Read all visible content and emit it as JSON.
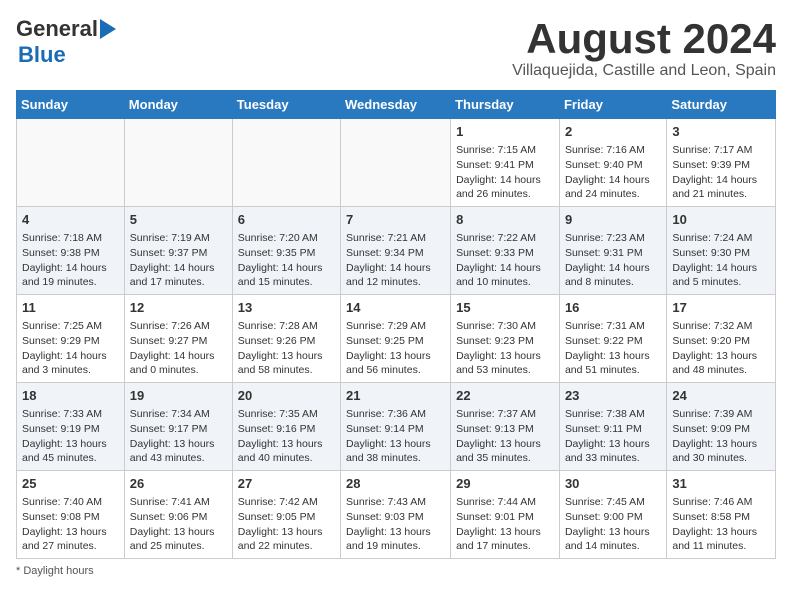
{
  "title": "August 2024",
  "subtitle": "Villaquejida, Castille and Leon, Spain",
  "logo": {
    "line1": "General",
    "line2": "Blue"
  },
  "footer_note": "Daylight hours",
  "days_of_week": [
    "Sunday",
    "Monday",
    "Tuesday",
    "Wednesday",
    "Thursday",
    "Friday",
    "Saturday"
  ],
  "weeks": [
    [
      {
        "day": "",
        "info": ""
      },
      {
        "day": "",
        "info": ""
      },
      {
        "day": "",
        "info": ""
      },
      {
        "day": "",
        "info": ""
      },
      {
        "day": "1",
        "info": "Sunrise: 7:15 AM\nSunset: 9:41 PM\nDaylight: 14 hours and 26 minutes."
      },
      {
        "day": "2",
        "info": "Sunrise: 7:16 AM\nSunset: 9:40 PM\nDaylight: 14 hours and 24 minutes."
      },
      {
        "day": "3",
        "info": "Sunrise: 7:17 AM\nSunset: 9:39 PM\nDaylight: 14 hours and 21 minutes."
      }
    ],
    [
      {
        "day": "4",
        "info": "Sunrise: 7:18 AM\nSunset: 9:38 PM\nDaylight: 14 hours and 19 minutes."
      },
      {
        "day": "5",
        "info": "Sunrise: 7:19 AM\nSunset: 9:37 PM\nDaylight: 14 hours and 17 minutes."
      },
      {
        "day": "6",
        "info": "Sunrise: 7:20 AM\nSunset: 9:35 PM\nDaylight: 14 hours and 15 minutes."
      },
      {
        "day": "7",
        "info": "Sunrise: 7:21 AM\nSunset: 9:34 PM\nDaylight: 14 hours and 12 minutes."
      },
      {
        "day": "8",
        "info": "Sunrise: 7:22 AM\nSunset: 9:33 PM\nDaylight: 14 hours and 10 minutes."
      },
      {
        "day": "9",
        "info": "Sunrise: 7:23 AM\nSunset: 9:31 PM\nDaylight: 14 hours and 8 minutes."
      },
      {
        "day": "10",
        "info": "Sunrise: 7:24 AM\nSunset: 9:30 PM\nDaylight: 14 hours and 5 minutes."
      }
    ],
    [
      {
        "day": "11",
        "info": "Sunrise: 7:25 AM\nSunset: 9:29 PM\nDaylight: 14 hours and 3 minutes."
      },
      {
        "day": "12",
        "info": "Sunrise: 7:26 AM\nSunset: 9:27 PM\nDaylight: 14 hours and 0 minutes."
      },
      {
        "day": "13",
        "info": "Sunrise: 7:28 AM\nSunset: 9:26 PM\nDaylight: 13 hours and 58 minutes."
      },
      {
        "day": "14",
        "info": "Sunrise: 7:29 AM\nSunset: 9:25 PM\nDaylight: 13 hours and 56 minutes."
      },
      {
        "day": "15",
        "info": "Sunrise: 7:30 AM\nSunset: 9:23 PM\nDaylight: 13 hours and 53 minutes."
      },
      {
        "day": "16",
        "info": "Sunrise: 7:31 AM\nSunset: 9:22 PM\nDaylight: 13 hours and 51 minutes."
      },
      {
        "day": "17",
        "info": "Sunrise: 7:32 AM\nSunset: 9:20 PM\nDaylight: 13 hours and 48 minutes."
      }
    ],
    [
      {
        "day": "18",
        "info": "Sunrise: 7:33 AM\nSunset: 9:19 PM\nDaylight: 13 hours and 45 minutes."
      },
      {
        "day": "19",
        "info": "Sunrise: 7:34 AM\nSunset: 9:17 PM\nDaylight: 13 hours and 43 minutes."
      },
      {
        "day": "20",
        "info": "Sunrise: 7:35 AM\nSunset: 9:16 PM\nDaylight: 13 hours and 40 minutes."
      },
      {
        "day": "21",
        "info": "Sunrise: 7:36 AM\nSunset: 9:14 PM\nDaylight: 13 hours and 38 minutes."
      },
      {
        "day": "22",
        "info": "Sunrise: 7:37 AM\nSunset: 9:13 PM\nDaylight: 13 hours and 35 minutes."
      },
      {
        "day": "23",
        "info": "Sunrise: 7:38 AM\nSunset: 9:11 PM\nDaylight: 13 hours and 33 minutes."
      },
      {
        "day": "24",
        "info": "Sunrise: 7:39 AM\nSunset: 9:09 PM\nDaylight: 13 hours and 30 minutes."
      }
    ],
    [
      {
        "day": "25",
        "info": "Sunrise: 7:40 AM\nSunset: 9:08 PM\nDaylight: 13 hours and 27 minutes."
      },
      {
        "day": "26",
        "info": "Sunrise: 7:41 AM\nSunset: 9:06 PM\nDaylight: 13 hours and 25 minutes."
      },
      {
        "day": "27",
        "info": "Sunrise: 7:42 AM\nSunset: 9:05 PM\nDaylight: 13 hours and 22 minutes."
      },
      {
        "day": "28",
        "info": "Sunrise: 7:43 AM\nSunset: 9:03 PM\nDaylight: 13 hours and 19 minutes."
      },
      {
        "day": "29",
        "info": "Sunrise: 7:44 AM\nSunset: 9:01 PM\nDaylight: 13 hours and 17 minutes."
      },
      {
        "day": "30",
        "info": "Sunrise: 7:45 AM\nSunset: 9:00 PM\nDaylight: 13 hours and 14 minutes."
      },
      {
        "day": "31",
        "info": "Sunrise: 7:46 AM\nSunset: 8:58 PM\nDaylight: 13 hours and 11 minutes."
      }
    ]
  ]
}
